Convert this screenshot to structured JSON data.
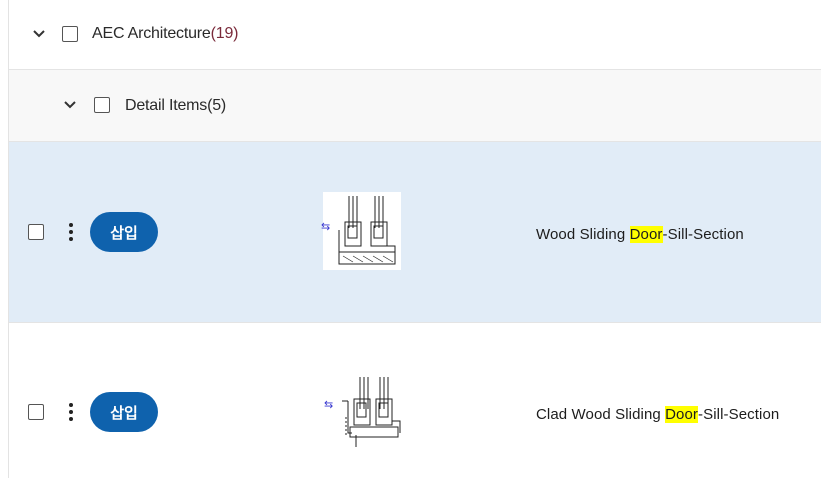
{
  "groups": [
    {
      "label": "AEC Architecture",
      "count": "(19)"
    },
    {
      "label": "Detail Items",
      "count": "(5)"
    }
  ],
  "items": [
    {
      "name_before": "Wood Sliding ",
      "name_highlight": "Door",
      "name_after": "-Sill-Section",
      "button_label": "삽입",
      "selected": true
    },
    {
      "name_before": "Clad Wood Sliding ",
      "name_highlight": "Door",
      "name_after": "-Sill-Section",
      "button_label": "삽입",
      "selected": false
    }
  ],
  "icons": {
    "expand": "chevron-down-icon",
    "menu": "kebab-menu-icon",
    "link": "link-arrows-icon"
  },
  "colors": {
    "accent": "#0f62ad",
    "selected_row": "#e1ecf7",
    "highlight": "#ffff00"
  }
}
